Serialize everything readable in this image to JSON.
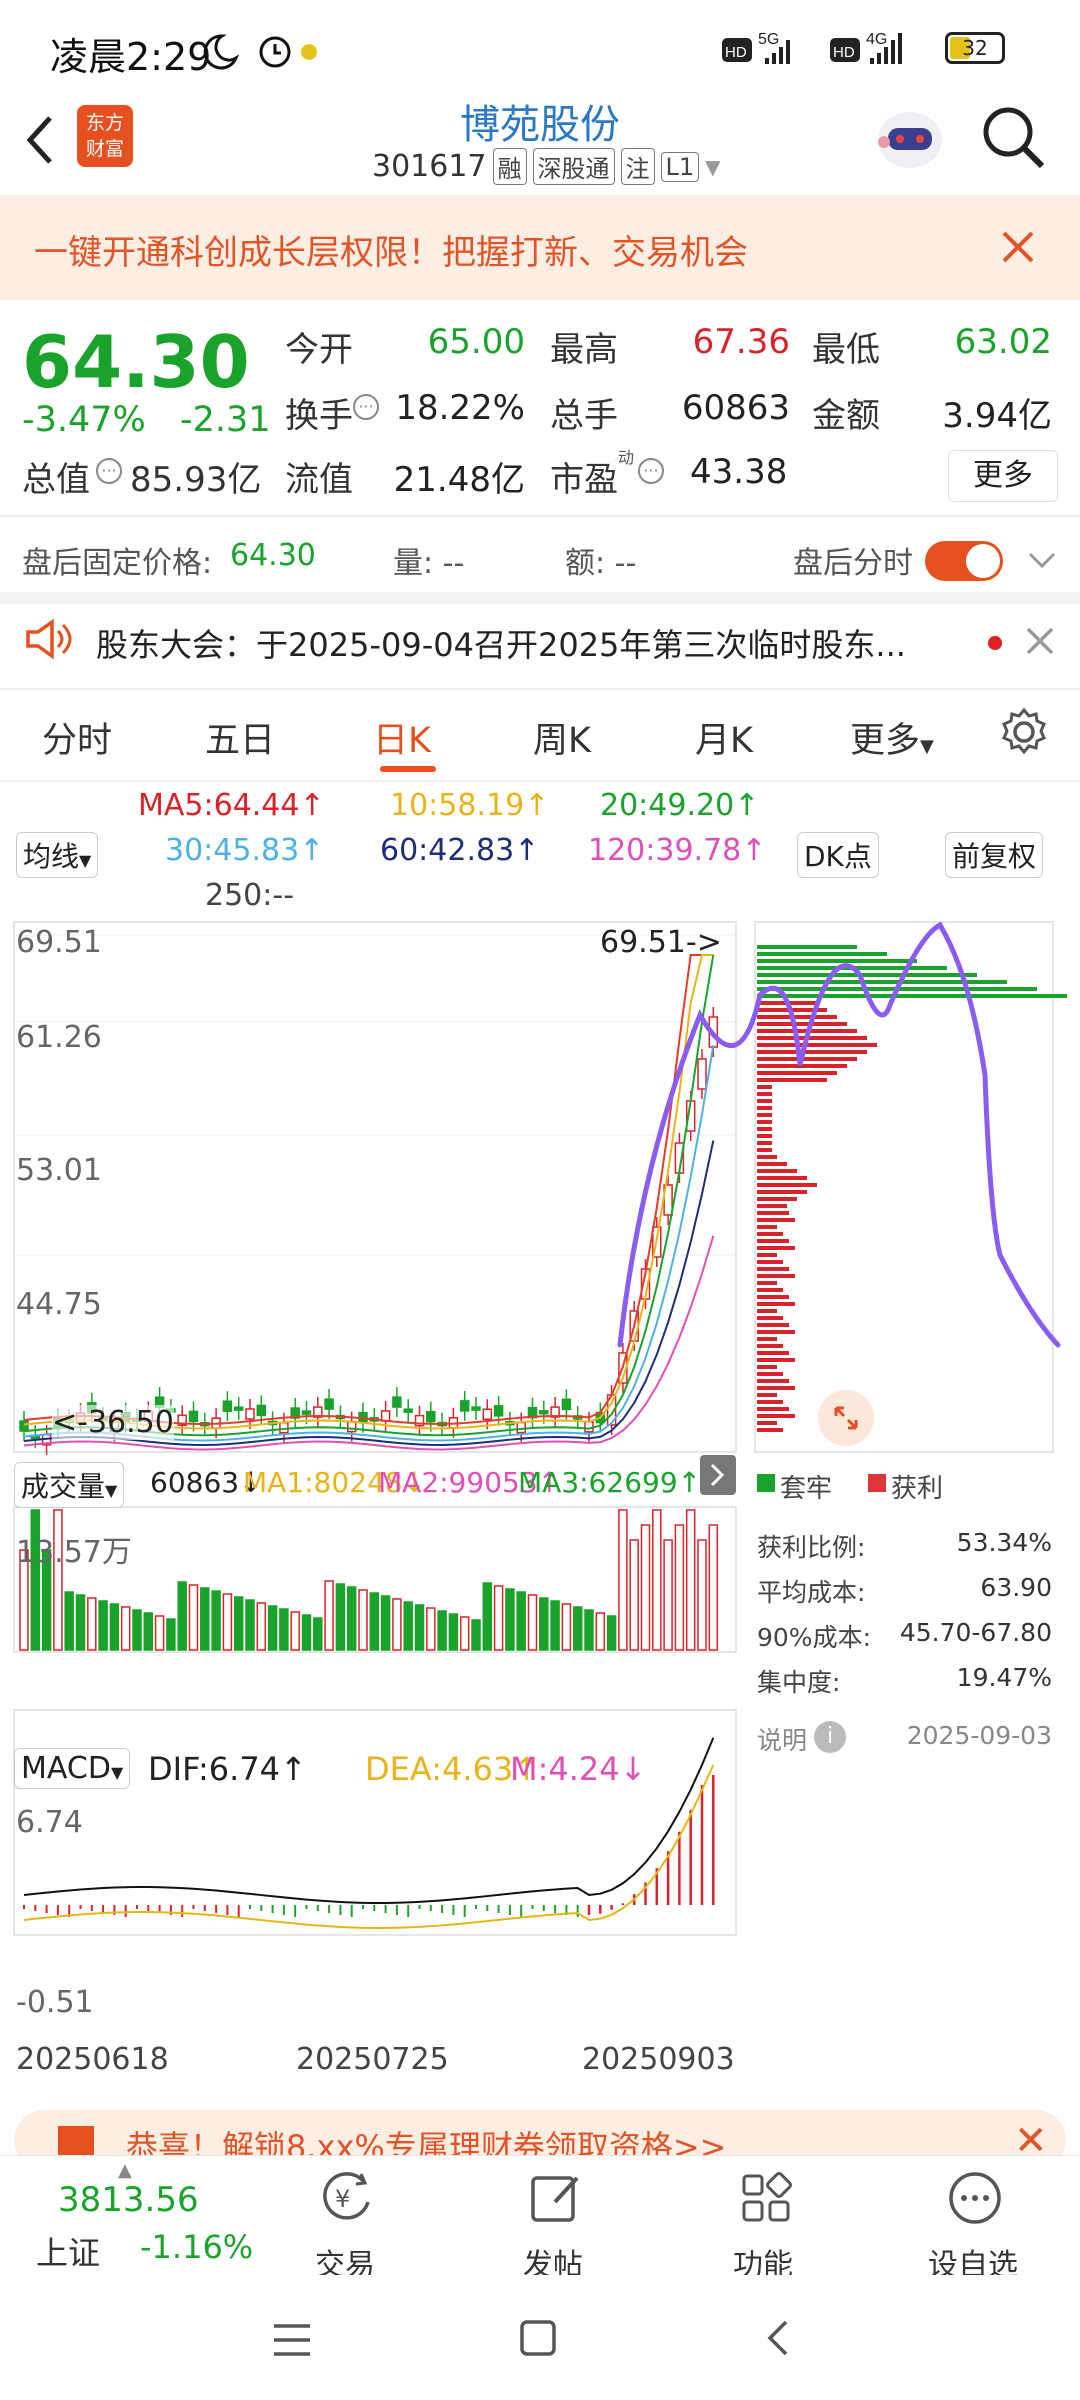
{
  "status": {
    "time": "凌晨2:29",
    "battery": "32",
    "net1": "5G",
    "net2": "4G"
  },
  "header": {
    "title": "博苑股份",
    "code": "301617",
    "tags": [
      "融",
      "深股通",
      "注",
      "L1"
    ],
    "logo_text": "东方财富"
  },
  "banner": {
    "text": "一键开通科创成长层权限！把握打新、交易机会"
  },
  "quote": {
    "price": "64.30",
    "change_pct": "-3.47%",
    "change": "-2.31",
    "open_label": "今开",
    "open": "65.00",
    "high_label": "最高",
    "high": "67.36",
    "low_label": "最低",
    "low": "63.02",
    "turnover_label": "换手",
    "turnover": "18.22%",
    "volume_label": "总手",
    "volume": "60863",
    "amount_label": "金额",
    "amount": "3.94亿",
    "mcap_label": "总值",
    "mcap": "85.93亿",
    "float_label": "流值",
    "float": "21.48亿",
    "pe_label": "市盈",
    "pe_sup": "动",
    "pe": "43.38",
    "more": "更多"
  },
  "afterhours": {
    "label": "盘后固定价格:",
    "price": "64.30",
    "vol_label": "量: --",
    "amt_label": "额: --",
    "toggle_label": "盘后分时"
  },
  "notice": {
    "text": "股东大会：于2025-09-04召开2025年第三次临时股东..."
  },
  "tabs": [
    "分时",
    "五日",
    "日K",
    "周K",
    "月K",
    "更多"
  ],
  "ma_row": {
    "ma5": "MA5:64.44↑",
    "ma10": "10:58.19↑",
    "ma20": "20:49.20↑",
    "ma30": "30:45.83↑",
    "ma60": "60:42.83↑",
    "ma120": "120:39.78↑",
    "ma250": "250:--",
    "avg_select": "均线",
    "dk": "DK点",
    "fq": "前复权"
  },
  "kline": {
    "y_labels": [
      "69.51",
      "61.26",
      "53.01",
      "44.75",
      "36.50"
    ],
    "high_tag": "69.51->",
    "low_tag": "<-36.50"
  },
  "volume_panel": {
    "label": "成交量",
    "v": "60863↓",
    "ma1": "MA1:80248↓",
    "ma2": "MA2:99053↑",
    "ma3": "MA3:62699↑",
    "ytop": "13.57万"
  },
  "macd_panel": {
    "label": "MACD",
    "dif": "DIF:6.74↑",
    "dea": "DEA:4.63↑",
    "m": "M:4.24↓",
    "ytop": "6.74",
    "ybot": "-0.51"
  },
  "dates": [
    "20250618",
    "20250725",
    "20250903"
  ],
  "chip": {
    "legend_trap": "套牢",
    "legend_profit": "获利",
    "stats": [
      {
        "label": "获利比例:",
        "value": "53.34%"
      },
      {
        "label": "平均成本:",
        "value": "63.90"
      },
      {
        "label": "90%成本:",
        "value": "45.70-67.80"
      },
      {
        "label": "集中度:",
        "value": "19.47%"
      }
    ],
    "note": "说明",
    "date": "2025-09-03"
  },
  "promo": {
    "text": "恭喜！解锁8.xx%专属理财券领取资格>>"
  },
  "index": {
    "value": "3813.56",
    "name": "上证",
    "pct": "-1.16%"
  },
  "nav": [
    "交易",
    "发帖",
    "功能",
    "设自选"
  ],
  "colors": {
    "accent": "#e6501e",
    "up": "#d8232a",
    "down": "#1aa32b",
    "link": "#2a78c8"
  }
}
